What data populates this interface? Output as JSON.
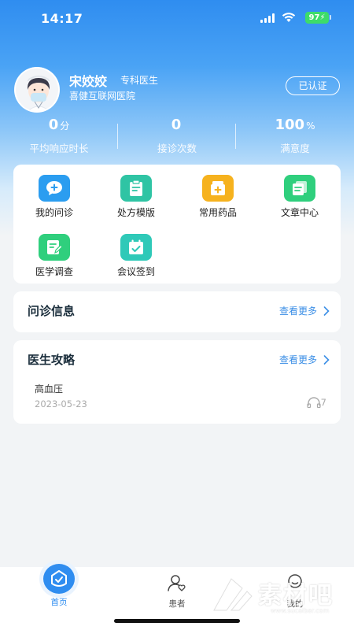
{
  "status_bar": {
    "time": "14:17",
    "battery": "97"
  },
  "profile": {
    "name": "宋姣姣",
    "title": "专科医生",
    "hospital": "喜健互联网医院",
    "verified_label": "已认证"
  },
  "stats": [
    {
      "value": "0",
      "unit": "分",
      "label": "平均响应时长"
    },
    {
      "value": "0",
      "unit": "",
      "label": "接诊次数"
    },
    {
      "value": "100",
      "unit": "%",
      "label": "满意度"
    }
  ],
  "functions": [
    {
      "label": "我的问诊",
      "icon": "chat-plus-icon",
      "color": "#2b9df0"
    },
    {
      "label": "处方模版",
      "icon": "clipboard-icon",
      "color": "#2fc4a4"
    },
    {
      "label": "常用药品",
      "icon": "medicine-box-icon",
      "color": "#f6b21e"
    },
    {
      "label": "文章中心",
      "icon": "documents-icon",
      "color": "#2fcf7d"
    },
    {
      "label": "医学调查",
      "icon": "survey-edit-icon",
      "color": "#2fcf7d"
    },
    {
      "label": "会议签到",
      "icon": "calendar-check-icon",
      "color": "#2fc9b8"
    }
  ],
  "consult_section": {
    "title": "问诊信息",
    "more": "查看更多"
  },
  "guide_section": {
    "title": "医生攻略",
    "more": "查看更多",
    "articles": [
      {
        "title": "高血压",
        "date": "2023-05-23",
        "views": "7"
      }
    ]
  },
  "tabbar": [
    {
      "label": "首页",
      "icon": "home-shield-icon",
      "active": true
    },
    {
      "label": "患者",
      "icon": "patient-icon",
      "active": false
    },
    {
      "label": "我的",
      "icon": "profile-icon",
      "active": false
    }
  ],
  "watermark": {
    "text": "素材吧",
    "sub": "www.sucaibar.com"
  }
}
